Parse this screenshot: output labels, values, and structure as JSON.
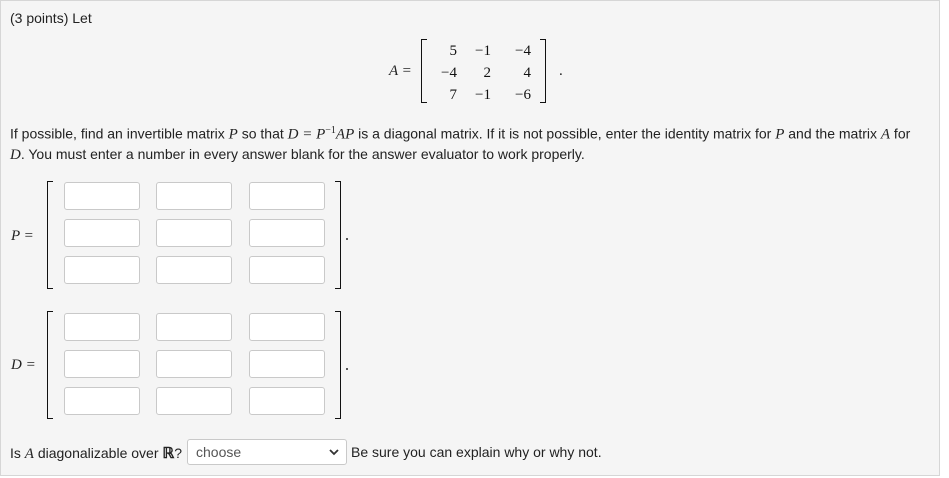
{
  "question": {
    "header": "(3 points) Let",
    "matrix_A_label": "A =",
    "matrix_A": [
      [
        "5",
        "−1",
        "−4"
      ],
      [
        "−4",
        "2",
        "4"
      ],
      [
        "7",
        "−1",
        "−6"
      ]
    ],
    "matrix_A_end": ".",
    "para": {
      "t1": "If possible, find an invertible matrix ",
      "P1": "P",
      "t2": " so that ",
      "eq": "D = P",
      "exp": "−1",
      "eq2": "AP",
      "t3": " is a diagonal matrix. If it is not possible, enter the identity matrix for ",
      "P2": "P",
      "t4": " and the matrix ",
      "A1": "A",
      "t5": " for",
      "D1": "D",
      "t6": ". You must enter a number in every answer blank for the answer evaluator to work properly."
    }
  },
  "answer": {
    "P_label": "P =",
    "D_label": "D =",
    "P_values": [
      "",
      "",
      "",
      "",
      "",
      "",
      "",
      "",
      ""
    ],
    "D_values": [
      "",
      "",
      "",
      "",
      "",
      "",
      "",
      "",
      ""
    ]
  },
  "diag": {
    "q1": "Is ",
    "A": "A",
    "q2": " diagonalizable over ",
    "R": "ℝ",
    "q3": "?",
    "select_value": "choose",
    "select_icon": "chevron-down-icon",
    "hint": "Be sure you can explain why or why not."
  }
}
